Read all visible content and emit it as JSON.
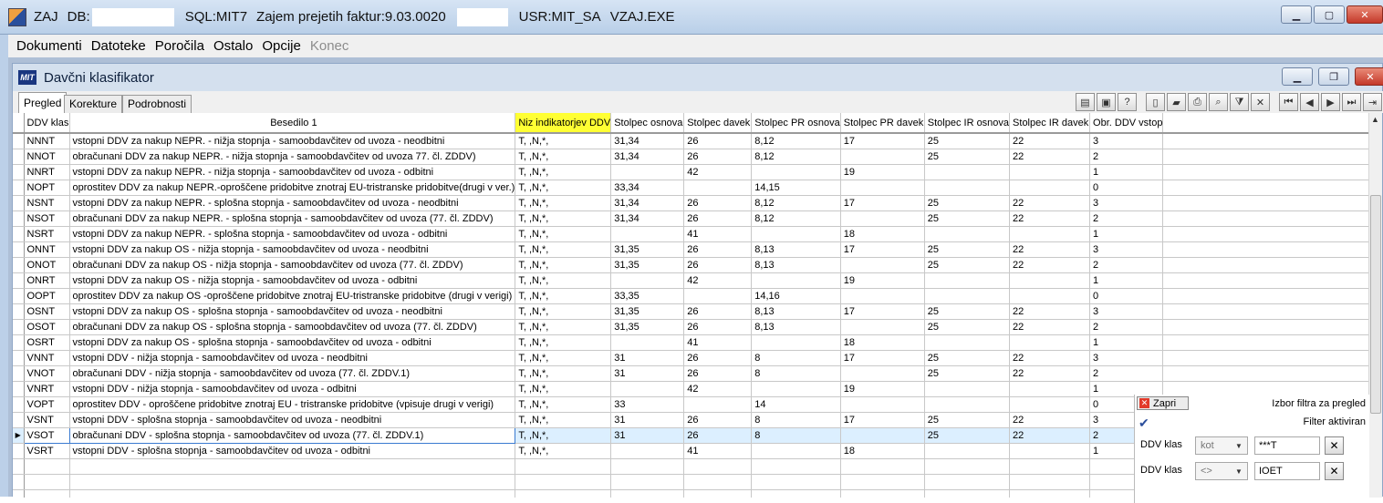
{
  "titlebar": {
    "app": "ZAJ",
    "db_label": "DB:",
    "sql": "SQL:MIT7",
    "title": "Zajem prejetih faktur:9.03.0020",
    "user": "USR:MIT_SA",
    "exe": "VZAJ.EXE"
  },
  "menu": [
    "Dokumenti",
    "Datoteke",
    "Poročila",
    "Ostalo",
    "Opcije",
    "Konec"
  ],
  "child": {
    "title": "Davčni klasifikator",
    "logo": "MIT"
  },
  "tabs": [
    "Pregled",
    "Korekture",
    "Podrobnosti"
  ],
  "grid": {
    "columns": [
      "DDV klas",
      "Besedilo 1",
      "Niz indikatorjev DDV",
      "Stolpec osnova",
      "Stolpec davek",
      "Stolpec PR osnova",
      "Stolpec PR davek",
      "Stolpec IR osnova",
      "Stolpec IR davek",
      "Obr. DDV vstop"
    ],
    "rows": [
      [
        "NNNT",
        "vstopni DDV za nakup NEPR. - nižja stopnja - samoobdavčitev od uvoza - neodbitni",
        "T, ,N,*,",
        "31,34",
        "26",
        "8,12",
        "17",
        "25",
        "22",
        "3"
      ],
      [
        "NNOT",
        "obračunani DDV za nakup NEPR. - nižja stopnja - samoobdavčitev od uvoza 77. čl. ZDDV)",
        "T, ,N,*,",
        "31,34",
        "26",
        "8,12",
        "",
        "25",
        "22",
        "2"
      ],
      [
        "NNRT",
        "vstopni DDV za nakup NEPR. - nižja stopnja - samoobdavčitev od uvoza - odbitni",
        "T, ,N,*,",
        "",
        "42",
        "",
        "19",
        "",
        "",
        "1"
      ],
      [
        "NOPT",
        "oprostitev DDV za nakup NEPR.-oproščene pridobitve znotraj EU-tristranske pridobitve(drugi v ver.)",
        "T, ,N,*,",
        "33,34",
        "",
        "14,15",
        "",
        "",
        "",
        "0"
      ],
      [
        "NSNT",
        "vstopni DDV za nakup NEPR. - splošna stopnja - samoobdavčitev od uvoza - neodbitni",
        "T, ,N,*,",
        "31,34",
        "26",
        "8,12",
        "17",
        "25",
        "22",
        "3"
      ],
      [
        "NSOT",
        "obračunani DDV za nakup NEPR. - splošna stopnja - samoobdavčitev od uvoza (77. čl. ZDDV)",
        "T, ,N,*,",
        "31,34",
        "26",
        "8,12",
        "",
        "25",
        "22",
        "2"
      ],
      [
        "NSRT",
        "vstopni DDV za nakup NEPR. - splošna stopnja - samoobdavčitev od uvoza - odbitni",
        "T, ,N,*,",
        "",
        "41",
        "",
        "18",
        "",
        "",
        "1"
      ],
      [
        "ONNT",
        "vstopni DDV za nakup OS - nižja stopnja - samoobdavčitev od uvoza - neodbitni",
        "T, ,N,*,",
        "31,35",
        "26",
        "8,13",
        "17",
        "25",
        "22",
        "3"
      ],
      [
        "ONOT",
        "obračunani DDV za nakup OS - nižja stopnja - samoobdavčitev od uvoza (77. čl. ZDDV)",
        "T, ,N,*,",
        "31,35",
        "26",
        "8,13",
        "",
        "25",
        "22",
        "2"
      ],
      [
        "ONRT",
        "vstopni DDV za nakup OS - nižja stopnja - samoobdavčitev od uvoza - odbitni",
        "T, ,N,*,",
        "",
        "42",
        "",
        "19",
        "",
        "",
        "1"
      ],
      [
        "OOPT",
        "oprostitev DDV za nakup OS -oproščene pridobitve znotraj EU-tristranske pridobitve (drugi v verigi)",
        "T, ,N,*,",
        "33,35",
        "",
        "14,16",
        "",
        "",
        "",
        "0"
      ],
      [
        "OSNT",
        "vstopni DDV za nakup OS - splošna stopnja - samoobdavčitev od uvoza - neodbitni",
        "T, ,N,*,",
        "31,35",
        "26",
        "8,13",
        "17",
        "25",
        "22",
        "3"
      ],
      [
        "OSOT",
        "obračunani DDV za nakup OS - splošna stopnja - samoobdavčitev od uvoza (77. čl. ZDDV)",
        "T, ,N,*,",
        "31,35",
        "26",
        "8,13",
        "",
        "25",
        "22",
        "2"
      ],
      [
        "OSRT",
        "vstopni DDV za nakup OS - splošna stopnja - samoobdavčitev od uvoza - odbitni",
        "T, ,N,*,",
        "",
        "41",
        "",
        "18",
        "",
        "",
        "1"
      ],
      [
        "VNNT",
        "vstopni DDV - nižja stopnja - samoobdavčitev od uvoza - neodbitni",
        "T, ,N,*,",
        "31",
        "26",
        "8",
        "17",
        "25",
        "22",
        "3"
      ],
      [
        "VNOT",
        "obračunani DDV - nižja stopnja - samoobdavčitev od uvoza (77. čl. ZDDV.1)",
        "T, ,N,*,",
        "31",
        "26",
        "8",
        "",
        "25",
        "22",
        "2"
      ],
      [
        "VNRT",
        "vstopni DDV - nižja stopnja - samoobdavčitev od uvoza - odbitni",
        "T, ,N,*,",
        "",
        "42",
        "",
        "19",
        "",
        "",
        "1"
      ],
      [
        "VOPT",
        "oprostitev DDV - oproščene pridobitve znotraj EU - tristranske pridobitve (vpisuje drugi v verigi)",
        "T, ,N,*,",
        "33",
        "",
        "14",
        "",
        "",
        "",
        "0"
      ],
      [
        "VSNT",
        "vstopni DDV - splošna stopnja - samoobdavčitev od uvoza - neodbitni",
        "T, ,N,*,",
        "31",
        "26",
        "8",
        "17",
        "25",
        "22",
        "3"
      ],
      [
        "VSOT",
        "obračunani DDV - splošna stopnja - samoobdavčitev od uvoza (77. čl. ZDDV.1)",
        "T, ,N,*,",
        "31",
        "26",
        "8",
        "",
        "25",
        "22",
        "2"
      ],
      [
        "VSRT",
        "vstopni DDV - splošna stopnja - samoobdavčitev od uvoza - odbitni",
        "T, ,N,*,",
        "",
        "41",
        "",
        "18",
        "",
        "",
        "1"
      ]
    ],
    "selected_row": 19
  },
  "filter": {
    "close_label": "Zapri",
    "title": "Izbor filtra za pregled",
    "status": "Filter aktiviran",
    "rows": [
      {
        "label": "DDV klas",
        "op": "kot",
        "value": "***T"
      },
      {
        "label": "DDV klas",
        "op": "<>",
        "value": "IOET"
      }
    ]
  }
}
